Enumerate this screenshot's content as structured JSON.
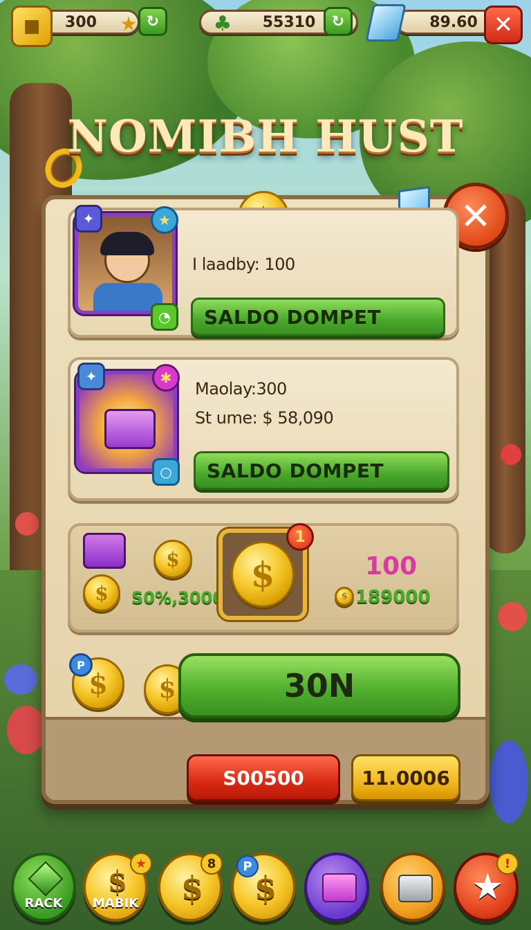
{
  "hud": {
    "gold_value": "300",
    "gem_value": "55310",
    "crystal_value": "89.60",
    "close_symbol": "✕"
  },
  "title": "NOMIBH HUST",
  "cards": [
    {
      "line1": "I laadby: 100",
      "button_label": "SALDO DOMPET"
    },
    {
      "line1": "Maolay:300",
      "line2": "St ume: $ 58,090",
      "button_label": "SALDO DOMPET"
    }
  ],
  "reward_row": {
    "left_value": "S0%,30000",
    "badge_count": "1",
    "right_top_value": "100",
    "right_bottom_value": "189000"
  },
  "main_button": {
    "label": "30N"
  },
  "footer_buttons": {
    "red_label": "S00500",
    "yellow_label": "11.0006"
  },
  "dock": [
    {
      "label": "RACK",
      "icon": "gem-icon",
      "color": "#4ab82c"
    },
    {
      "label": "MABIK",
      "icon": "coin-icon",
      "color": "#f6c628"
    },
    {
      "label": "",
      "icon": "coin-icon",
      "color": "#f6c628",
      "badge": "8"
    },
    {
      "label": "",
      "icon": "coin-icon",
      "color": "#f6c628"
    },
    {
      "label": "",
      "icon": "chest-icon",
      "color": "#8a4ad8"
    },
    {
      "label": "",
      "icon": "box-icon",
      "color": "#f2a020"
    },
    {
      "label": "",
      "icon": "star-icon",
      "color": "#e8401c",
      "badge": "!"
    }
  ],
  "colors": {
    "panel": "#efe1c0",
    "green": "#4aa82c",
    "red": "#d82a14",
    "gold": "#f6c628"
  }
}
